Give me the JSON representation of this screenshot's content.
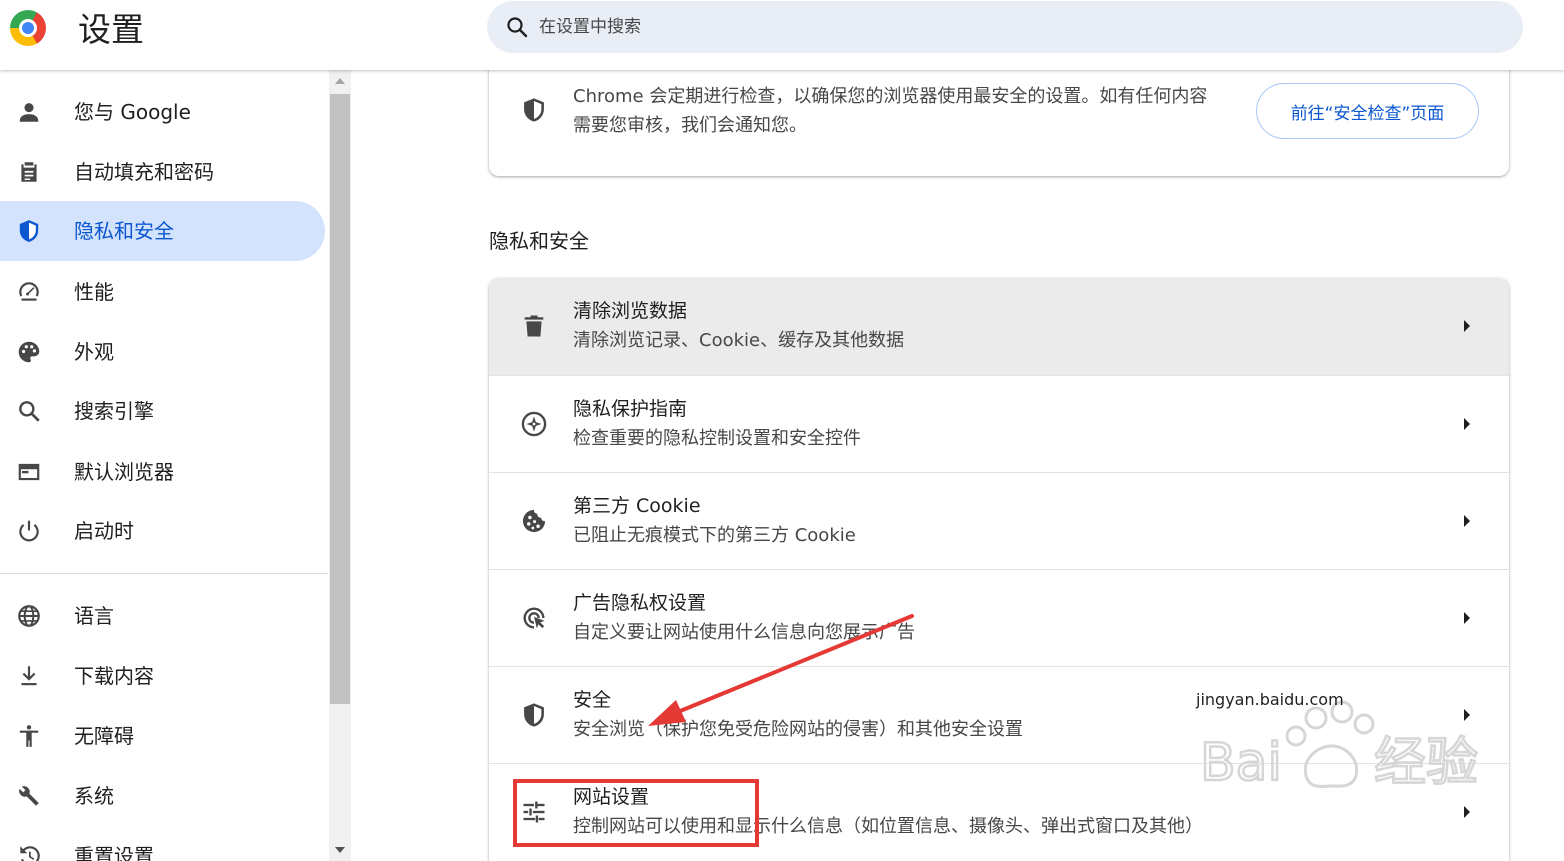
{
  "header": {
    "title": "设置",
    "search_placeholder": "在设置中搜索"
  },
  "sidebar": {
    "items": [
      {
        "label": "您与 Google",
        "icon": "person-icon"
      },
      {
        "label": "自动填充和密码",
        "icon": "clipboard-icon"
      },
      {
        "label": "隐私和安全",
        "icon": "shield-icon",
        "active": true
      },
      {
        "label": "性能",
        "icon": "speedometer-icon"
      },
      {
        "label": "外观",
        "icon": "palette-icon"
      },
      {
        "label": "搜索引擎",
        "icon": "search-icon"
      },
      {
        "label": "默认浏览器",
        "icon": "browser-icon"
      },
      {
        "label": "启动时",
        "icon": "power-icon"
      },
      {
        "label": "语言",
        "icon": "globe-icon"
      },
      {
        "label": "下载内容",
        "icon": "download-icon"
      },
      {
        "label": "无障碍",
        "icon": "accessibility-icon"
      },
      {
        "label": "系统",
        "icon": "wrench-icon"
      },
      {
        "label": "重置设置",
        "icon": "reset-icon"
      }
    ]
  },
  "safety_check": {
    "description": "Chrome 会定期进行检查，以确保您的浏览器使用最安全的设置。如有任何内容需要您审核，我们会通知您。",
    "button_label": "前往“安全检查”页面"
  },
  "privacy_section": {
    "title": "隐私和安全",
    "rows": [
      {
        "title": "清除浏览数据",
        "subtitle": "清除浏览记录、Cookie、缓存及其他数据",
        "icon": "trash-icon"
      },
      {
        "title": "隐私保护指南",
        "subtitle": "检查重要的隐私控制设置和安全控件",
        "icon": "compass-icon"
      },
      {
        "title": "第三方 Cookie",
        "subtitle": "已阻止无痕模式下的第三方 Cookie",
        "icon": "cookie-icon"
      },
      {
        "title": "广告隐私权设置",
        "subtitle": "自定义要让网站使用什么信息向您展示广告",
        "icon": "ad-privacy-icon"
      },
      {
        "title": "安全",
        "subtitle": "安全浏览（保护您免受危险网站的侵害）和其他安全设置",
        "icon": "security-shield-icon"
      },
      {
        "title": "网站设置",
        "subtitle": "控制网站可以使用和显示什么信息（如位置信息、摄像头、弹出式窗口及其他）",
        "icon": "tune-icon"
      }
    ]
  },
  "watermark": {
    "brand": "Baidu经验",
    "url": "jingyan.baidu.com"
  },
  "colors": {
    "accent": "#0b57d0",
    "active_bg": "#d3e3fd",
    "annotation_red": "#e53935"
  }
}
